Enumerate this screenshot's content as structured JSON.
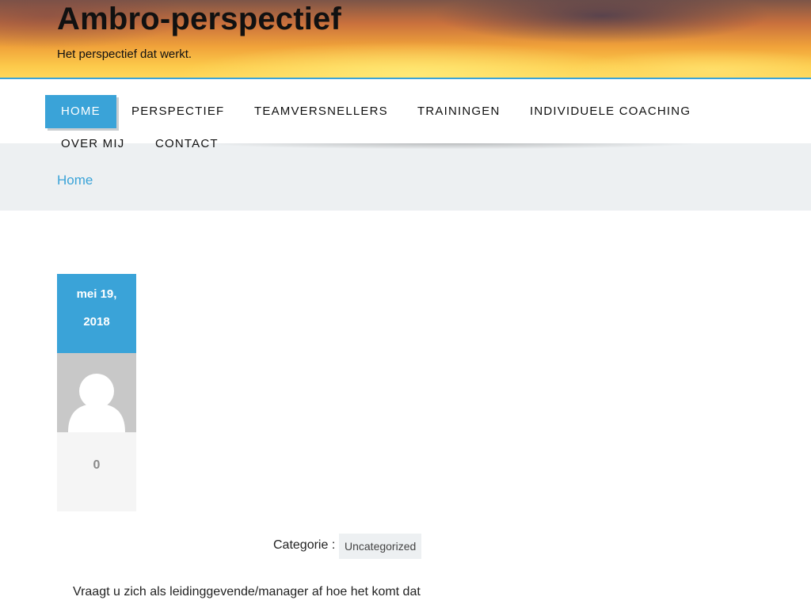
{
  "site": {
    "title": "Ambro-perspectief",
    "tagline": "Het perspectief dat werkt."
  },
  "nav": {
    "items": [
      {
        "label": "HOME",
        "active": true
      },
      {
        "label": "PERSPECTIEF",
        "active": false
      },
      {
        "label": "TEAMVERSNELLERS",
        "active": false
      },
      {
        "label": "TRAININGEN",
        "active": false
      },
      {
        "label": "INDIVIDUELE COACHING",
        "active": false
      },
      {
        "label": "OVER MIJ",
        "active": false
      },
      {
        "label": "CONTACT",
        "active": false
      }
    ]
  },
  "breadcrumb": {
    "home": "Home"
  },
  "post": {
    "date_line1": "mei 19,",
    "date_line2": "2018",
    "avatar_icon": "user-silhouette-icon",
    "comment_count": "0",
    "category_label": "Categorie :",
    "category": "Uncategorized",
    "excerpt": "Vraagt u zich als leidinggevende/manager af hoe het komt dat"
  },
  "colors": {
    "accent": "#3aa3d8",
    "band": "#edf0f2",
    "avatar_bg": "#c8c8c8"
  }
}
